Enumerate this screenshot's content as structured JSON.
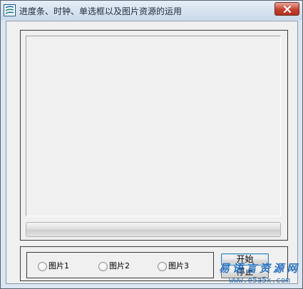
{
  "window": {
    "title": "进度条、时钟、单选框以及图片资源的运用",
    "icon": "app-logo-icon",
    "close_icon": "close-icon"
  },
  "progress": {
    "value": 0
  },
  "radios": [
    {
      "label": "图片1",
      "checked": false
    },
    {
      "label": "图片2",
      "checked": false
    },
    {
      "label": "图片3",
      "checked": false
    }
  ],
  "buttons": {
    "start_label": "开始",
    "stop_label": "停止"
  },
  "watermark": {
    "cn": "易语言资源网",
    "en": "www.e5a5x.com"
  },
  "colors": {
    "close_red": "#c7402e",
    "watermark_blue": "#2a72c0",
    "progress_green": "#37b32b"
  }
}
